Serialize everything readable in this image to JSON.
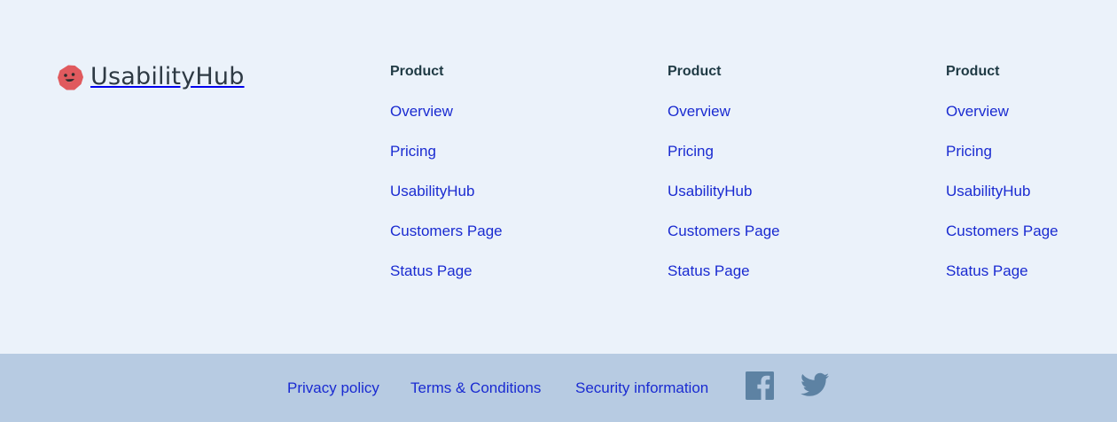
{
  "brand": {
    "name": "UsabilityHub",
    "logo_icon": "usabilityhub-logo-icon",
    "logo_color": "#e05a5e"
  },
  "columns": [
    {
      "heading": "Product",
      "links": [
        "Overview",
        "Pricing",
        "UsabilityHub",
        "Customers Page",
        "Status Page"
      ]
    },
    {
      "heading": "Product",
      "links": [
        "Overview",
        "Pricing",
        "UsabilityHub",
        "Customers Page",
        "Status Page"
      ]
    },
    {
      "heading": "Product",
      "links": [
        "Overview",
        "Pricing",
        "UsabilityHub",
        "Customers Page",
        "Status Page"
      ]
    }
  ],
  "bottom_bar": {
    "links": [
      "Privacy policy",
      "Terms & Conditions",
      "Security information"
    ],
    "social": [
      {
        "icon": "facebook-icon"
      },
      {
        "icon": "twitter-icon"
      }
    ],
    "social_color": "#5d82a3"
  },
  "colors": {
    "background": "#ebf2fa",
    "bottom_bar": "#b7cbe2",
    "link": "#1a2bd1",
    "heading": "#1f3a44"
  }
}
